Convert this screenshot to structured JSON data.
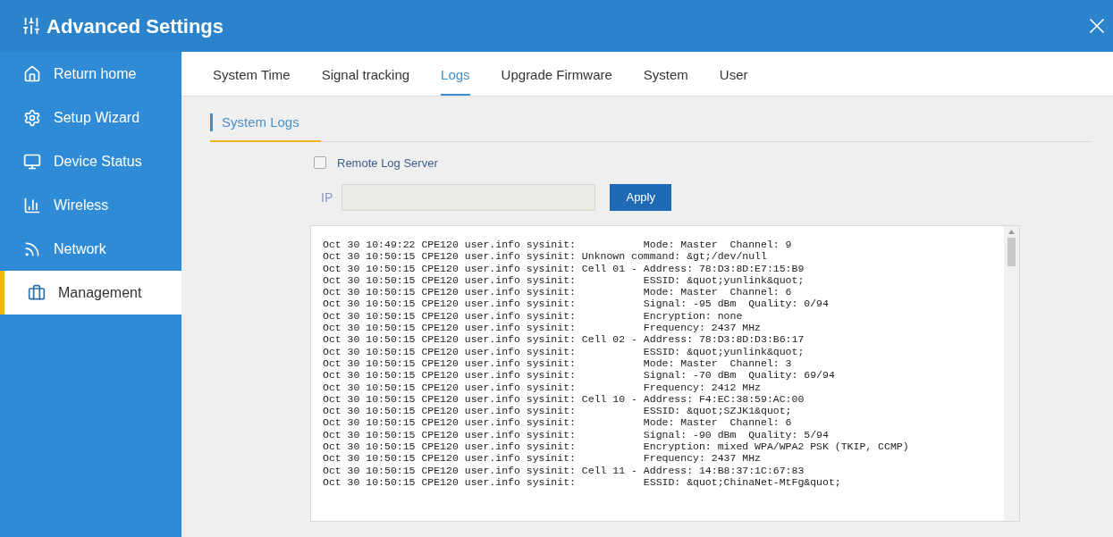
{
  "window": {
    "title": "Advanced Settings"
  },
  "sidebar": {
    "items": [
      {
        "label": "Return home",
        "selected": false
      },
      {
        "label": "Setup Wizard",
        "selected": false
      },
      {
        "label": "Device Status",
        "selected": false
      },
      {
        "label": "Wireless",
        "selected": false
      },
      {
        "label": "Network",
        "selected": false
      },
      {
        "label": "Management",
        "selected": true
      }
    ]
  },
  "tabs": [
    {
      "label": "System Time",
      "selected": false
    },
    {
      "label": "Signal tracking",
      "selected": false
    },
    {
      "label": "Logs",
      "selected": true
    },
    {
      "label": "Upgrade Firmware",
      "selected": false
    },
    {
      "label": "System",
      "selected": false
    },
    {
      "label": "User",
      "selected": false
    }
  ],
  "section": {
    "title": "System Logs"
  },
  "remote_log": {
    "label": "Remote Log Server",
    "checked": false
  },
  "ip_field": {
    "label": "IP"
  },
  "apply_button": "Apply",
  "log_lines": [
    "Oct 30 10:49:22 CPE120 user.info sysinit:           Mode: Master  Channel: 9",
    "Oct 30 10:50:15 CPE120 user.info sysinit: Unknown command: &gt;/dev/null",
    "Oct 30 10:50:15 CPE120 user.info sysinit: Cell 01 - Address: 78:D3:8D:E7:15:B9",
    "Oct 30 10:50:15 CPE120 user.info sysinit:           ESSID: &quot;yunlink&quot;",
    "Oct 30 10:50:15 CPE120 user.info sysinit:           Mode: Master  Channel: 6",
    "Oct 30 10:50:15 CPE120 user.info sysinit:           Signal: -95 dBm  Quality: 0/94",
    "Oct 30 10:50:15 CPE120 user.info sysinit:           Encryption: none",
    "Oct 30 10:50:15 CPE120 user.info sysinit:           Frequency: 2437 MHz",
    "Oct 30 10:50:15 CPE120 user.info sysinit: Cell 02 - Address: 78:D3:8D:D3:B6:17",
    "Oct 30 10:50:15 CPE120 user.info sysinit:           ESSID: &quot;yunlink&quot;",
    "Oct 30 10:50:15 CPE120 user.info sysinit:           Mode: Master  Channel: 3",
    "Oct 30 10:50:15 CPE120 user.info sysinit:           Signal: -70 dBm  Quality: 69/94",
    "Oct 30 10:50:15 CPE120 user.info sysinit:           Frequency: 2412 MHz",
    "Oct 30 10:50:15 CPE120 user.info sysinit: Cell 10 - Address: F4:EC:38:59:AC:00",
    "Oct 30 10:50:15 CPE120 user.info sysinit:           ESSID: &quot;SZJK1&quot;",
    "Oct 30 10:50:15 CPE120 user.info sysinit:           Mode: Master  Channel: 6",
    "Oct 30 10:50:15 CPE120 user.info sysinit:           Signal: -90 dBm  Quality: 5/94",
    "Oct 30 10:50:15 CPE120 user.info sysinit:           Encryption: mixed WPA/WPA2 PSK (TKIP, CCMP)",
    "Oct 30 10:50:15 CPE120 user.info sysinit:           Frequency: 2437 MHz",
    "Oct 30 10:50:15 CPE120 user.info sysinit: Cell 11 - Address: 14:B8:37:1C:67:83",
    "Oct 30 10:50:15 CPE120 user.info sysinit:           ESSID: &quot;ChinaNet-MtFg&quot;"
  ]
}
